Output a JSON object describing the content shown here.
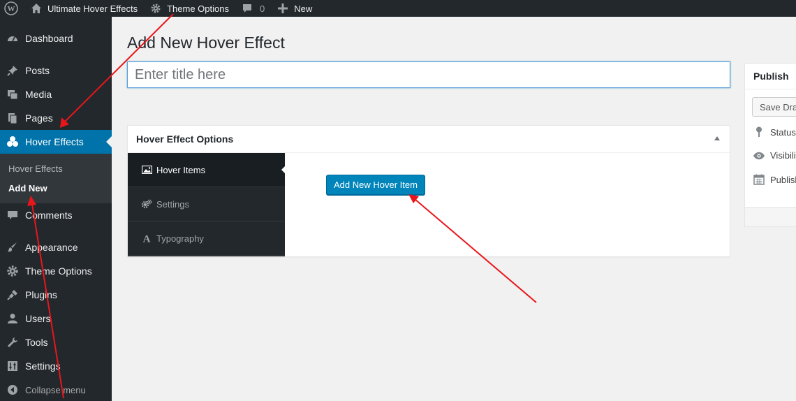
{
  "adminbar": {
    "site_name": "Ultimate Hover Effects",
    "theme_options": "Theme Options",
    "comments_count": "0",
    "new_label": "New"
  },
  "sidebar": {
    "items": [
      {
        "label": "Dashboard",
        "icon": "dashboard-icon"
      },
      {
        "label": "Posts",
        "icon": "pin-icon"
      },
      {
        "label": "Media",
        "icon": "media-icon"
      },
      {
        "label": "Pages",
        "icon": "pages-icon"
      },
      {
        "label": "Hover Effects",
        "icon": "hover-effects-icon"
      },
      {
        "label": "Comments",
        "icon": "comment-icon"
      },
      {
        "label": "Appearance",
        "icon": "brush-icon"
      },
      {
        "label": "Theme Options",
        "icon": "gear-icon"
      },
      {
        "label": "Plugins",
        "icon": "plug-icon"
      },
      {
        "label": "Users",
        "icon": "user-icon"
      },
      {
        "label": "Tools",
        "icon": "wrench-icon"
      },
      {
        "label": "Settings",
        "icon": "sliders-icon"
      }
    ],
    "submenu": [
      "Hover Effects",
      "Add New"
    ],
    "collapse_label": "Collapse menu"
  },
  "main": {
    "page_title": "Add New Hover Effect",
    "title_placeholder": "Enter title here",
    "postbox": {
      "title": "Hover Effect Options",
      "tabs": [
        {
          "label": "Hover Items",
          "icon": "image-icon"
        },
        {
          "label": "Settings",
          "icon": "gears-icon"
        },
        {
          "label": "Typography",
          "icon": "font-icon"
        }
      ],
      "add_button": "Add New Hover Item"
    },
    "publish": {
      "title": "Publish",
      "save_draft": "Save Draft",
      "status": "Status:",
      "visibility": "Visibility:",
      "publish_row": "Publish"
    }
  },
  "colors": {
    "admin_dark": "#23282d",
    "accent_blue": "#0073aa",
    "button_blue": "#0085ba",
    "annotation_red": "#e8161b"
  }
}
